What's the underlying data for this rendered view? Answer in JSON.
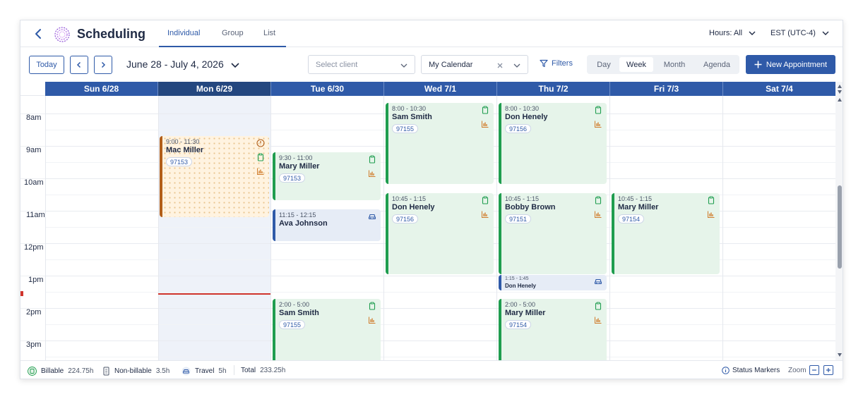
{
  "header": {
    "title": "Scheduling",
    "tabs": [
      {
        "label": "Individual",
        "active": true
      },
      {
        "label": "Group"
      },
      {
        "label": "List"
      }
    ],
    "hours_label": "Hours: All",
    "timezone_label": "EST (UTC-4)"
  },
  "toolbar": {
    "today_label": "Today",
    "date_range": "June 28 - July 4, 2026",
    "client_placeholder": "Select client",
    "calendar_value": "My Calendar",
    "filters_label": "Filters",
    "views": [
      "Day",
      "Week",
      "Month",
      "Agenda"
    ],
    "active_view": "Week",
    "new_appointment_label": "New Appointment"
  },
  "calendar": {
    "days": [
      "Sun 6/28",
      "Mon 6/29",
      "Tue 6/30",
      "Wed 7/1",
      "Thu 7/2",
      "Fri 7/3",
      "Sat 7/4"
    ],
    "today": "Mon 6/29",
    "hours": [
      "8am",
      "9am",
      "10am",
      "11am",
      "12pm",
      "1pm",
      "2pm",
      "3pm"
    ],
    "appointments": [
      {
        "day": "Mon 6/29",
        "time": "9:00 - 11:30",
        "name": "Mac Miller",
        "id": "97153",
        "style": "orange",
        "icons": [
          "alert-icon",
          "clipboard-icon",
          "chart-icon"
        ]
      },
      {
        "day": "Tue 6/30",
        "time": "9:30 - 11:00",
        "name": "Mary Miller",
        "id": "97153",
        "style": "green",
        "icons": [
          "clipboard-icon",
          "chart-icon"
        ]
      },
      {
        "day": "Tue 6/30",
        "time": "11:15 - 12:15",
        "name": "Ava Johnson",
        "style": "blue",
        "icons": [
          "car-icon"
        ]
      },
      {
        "day": "Tue 6/30",
        "time": "2:00 - 5:00",
        "name": "Sam Smith",
        "id": "97155",
        "style": "green",
        "icons": [
          "clipboard-icon",
          "chart-icon"
        ]
      },
      {
        "day": "Wed 7/1",
        "time": "8:00 - 10:30",
        "name": "Sam Smith",
        "id": "97155",
        "style": "green",
        "icons": [
          "clipboard-icon",
          "chart-icon"
        ]
      },
      {
        "day": "Wed 7/1",
        "time": "10:45 - 1:15",
        "name": "Don Henely",
        "id": "97156",
        "style": "green",
        "icons": [
          "clipboard-icon",
          "chart-icon"
        ]
      },
      {
        "day": "Thu 7/2",
        "time": "8:00 - 10:30",
        "name": "Don Henely",
        "id": "97156",
        "style": "green",
        "icons": [
          "clipboard-icon",
          "chart-icon"
        ]
      },
      {
        "day": "Thu 7/2",
        "time": "10:45 - 1:15",
        "name": "Bobby Brown",
        "id": "97151",
        "style": "green",
        "icons": [
          "clipboard-icon",
          "chart-icon"
        ]
      },
      {
        "day": "Thu 7/2",
        "time": "1:15 - 1:45",
        "name": "Don Henely",
        "style": "blue",
        "icons": [
          "car-icon"
        ]
      },
      {
        "day": "Thu 7/2",
        "time": "2:00 - 5:00",
        "name": "Mary Miller",
        "id": "97154",
        "style": "green",
        "icons": [
          "clipboard-icon",
          "chart-icon"
        ]
      },
      {
        "day": "Fri 7/3",
        "time": "10:45 - 1:15",
        "name": "Mary Miller",
        "id": "97154",
        "style": "green",
        "icons": [
          "clipboard-icon",
          "chart-icon"
        ]
      }
    ]
  },
  "footer": {
    "billable_label": "Billable",
    "billable_value": "224.75h",
    "nonbillable_label": "Non-billable",
    "nonbillable_value": "3.5h",
    "travel_label": "Travel",
    "travel_value": "5h",
    "total_label": "Total",
    "total_value": "233.25h",
    "status_markers_label": "Status Markers",
    "zoom_label": "Zoom"
  },
  "colors": {
    "primary": "#2f5aa8",
    "billable_green": "#1f9d4f",
    "travel_blue": "#2f5aa8",
    "warning_orange": "#b25f1a",
    "now_red": "#d0342c"
  }
}
